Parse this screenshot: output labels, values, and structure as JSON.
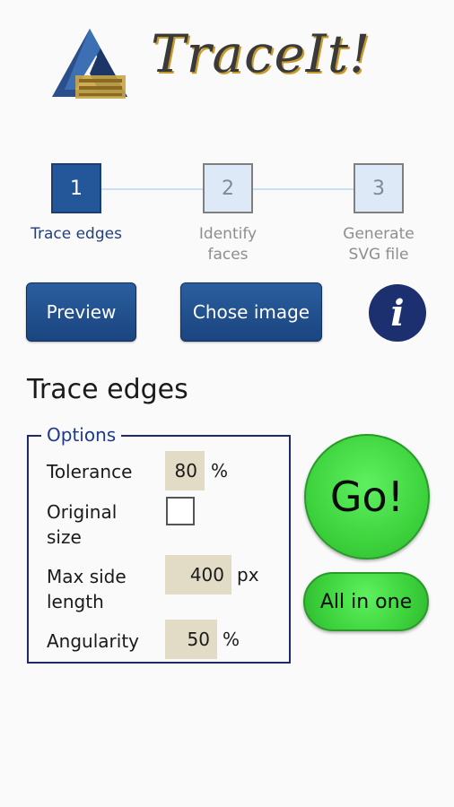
{
  "header": {
    "title": "TraceIt!",
    "logo_icon": "impossible-triangle-logo-icon"
  },
  "steps": [
    {
      "number": "1",
      "label": "Trace edges",
      "active": true
    },
    {
      "number": "2",
      "label": "Identify faces",
      "active": false
    },
    {
      "number": "3",
      "label": "Generate SVG file",
      "active": false
    }
  ],
  "actions": {
    "preview_label": "Preview",
    "choose_image_label": "Chose image",
    "info_icon": "info-icon",
    "info_glyph": "i"
  },
  "section": {
    "title": "Trace edges"
  },
  "options": {
    "legend": "Options",
    "tolerance": {
      "label": "Tolerance",
      "value": "80",
      "unit": "%"
    },
    "original_size": {
      "label": "Original size",
      "checked": false
    },
    "max_side_length": {
      "label": "Max side length",
      "value": "400",
      "unit": "px"
    },
    "angularity": {
      "label": "Angularity",
      "value": "50",
      "unit": "%"
    }
  },
  "run": {
    "go_label": "Go!",
    "all_in_one_label": "All in one"
  },
  "colors": {
    "accent_blue": "#24579a",
    "go_green": "#3ed43e",
    "options_border": "#1f2a6b"
  }
}
